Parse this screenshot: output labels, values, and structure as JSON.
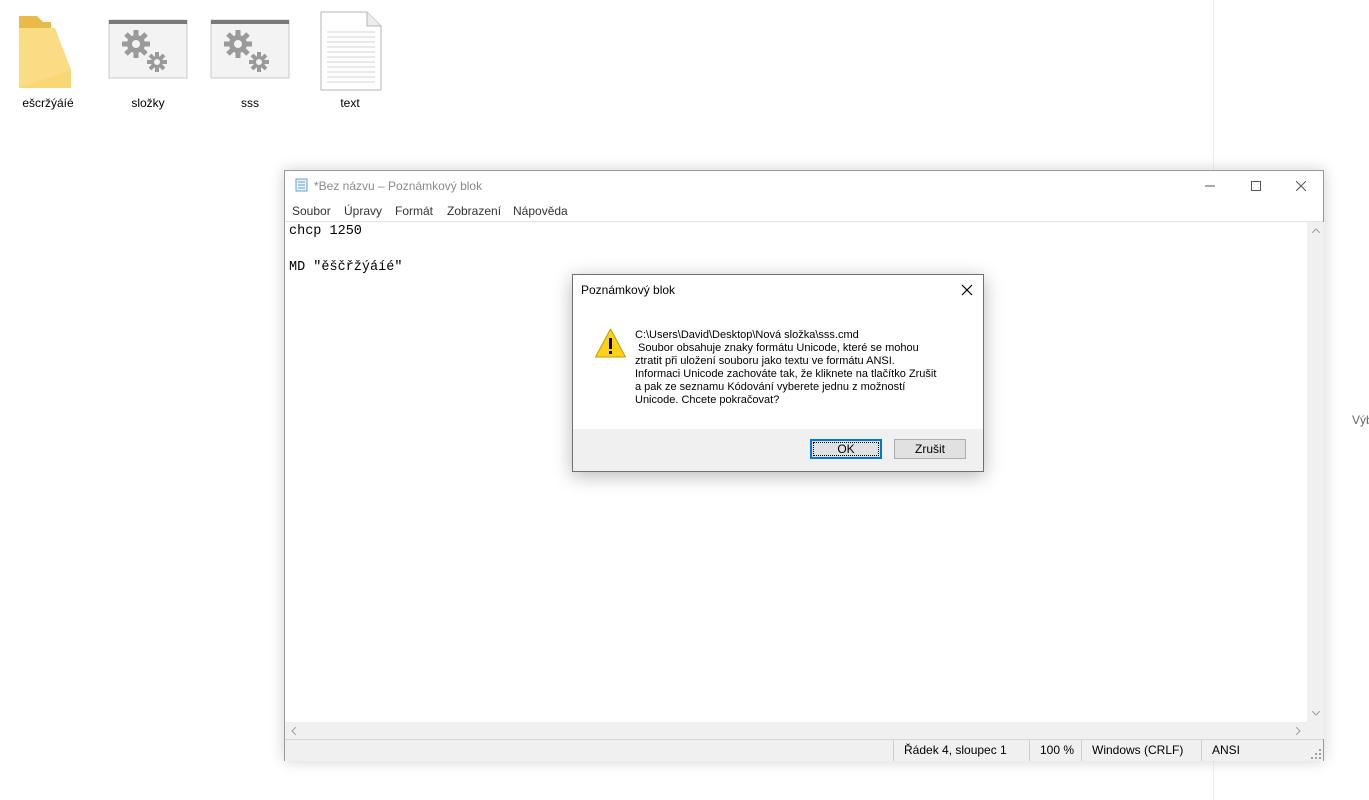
{
  "desktop": {
    "items": [
      {
        "label": "ešcržýáíé",
        "icon": "folder-icon"
      },
      {
        "label": "složky",
        "icon": "settings-file-icon"
      },
      {
        "label": "sss",
        "icon": "settings-file-icon"
      },
      {
        "label": "text",
        "icon": "text-document-icon"
      }
    ],
    "side_hint": "Výb"
  },
  "notepad": {
    "title": "*Bez názvu – Poznámkový blok",
    "menu": [
      "Soubor",
      "Úpravy",
      "Formát",
      "Zobrazení",
      "Nápověda"
    ],
    "content_lines": [
      "chcp 1250",
      "",
      "MD \"ěščřžýáíé\""
    ],
    "status": {
      "position": "Řádek 4, sloupec 1",
      "zoom": "100 %",
      "line_ending": "Windows (CRLF)",
      "encoding": "ANSI"
    }
  },
  "dialog": {
    "title": "Poznámkový blok",
    "message_lines": [
      "C:\\Users\\David\\Desktop\\Nová složka\\sss.cmd",
      " Soubor obsahuje znaky formátu Unicode, které se mohou",
      "ztratit při uložení souboru jako textu ve formátu ANSI.",
      "Informaci Unicode zachováte tak, že kliknete na tlačítko Zrušit",
      "a pak ze seznamu Kódování vyberete jednu z možností",
      "Unicode. Chcete pokračovat?"
    ],
    "ok_label": "OK",
    "cancel_label": "Zrušit",
    "icon": "warning-icon"
  },
  "colors": {
    "folder": "#f8d775",
    "accent": "#0078d7",
    "warning": "#fcd116"
  }
}
